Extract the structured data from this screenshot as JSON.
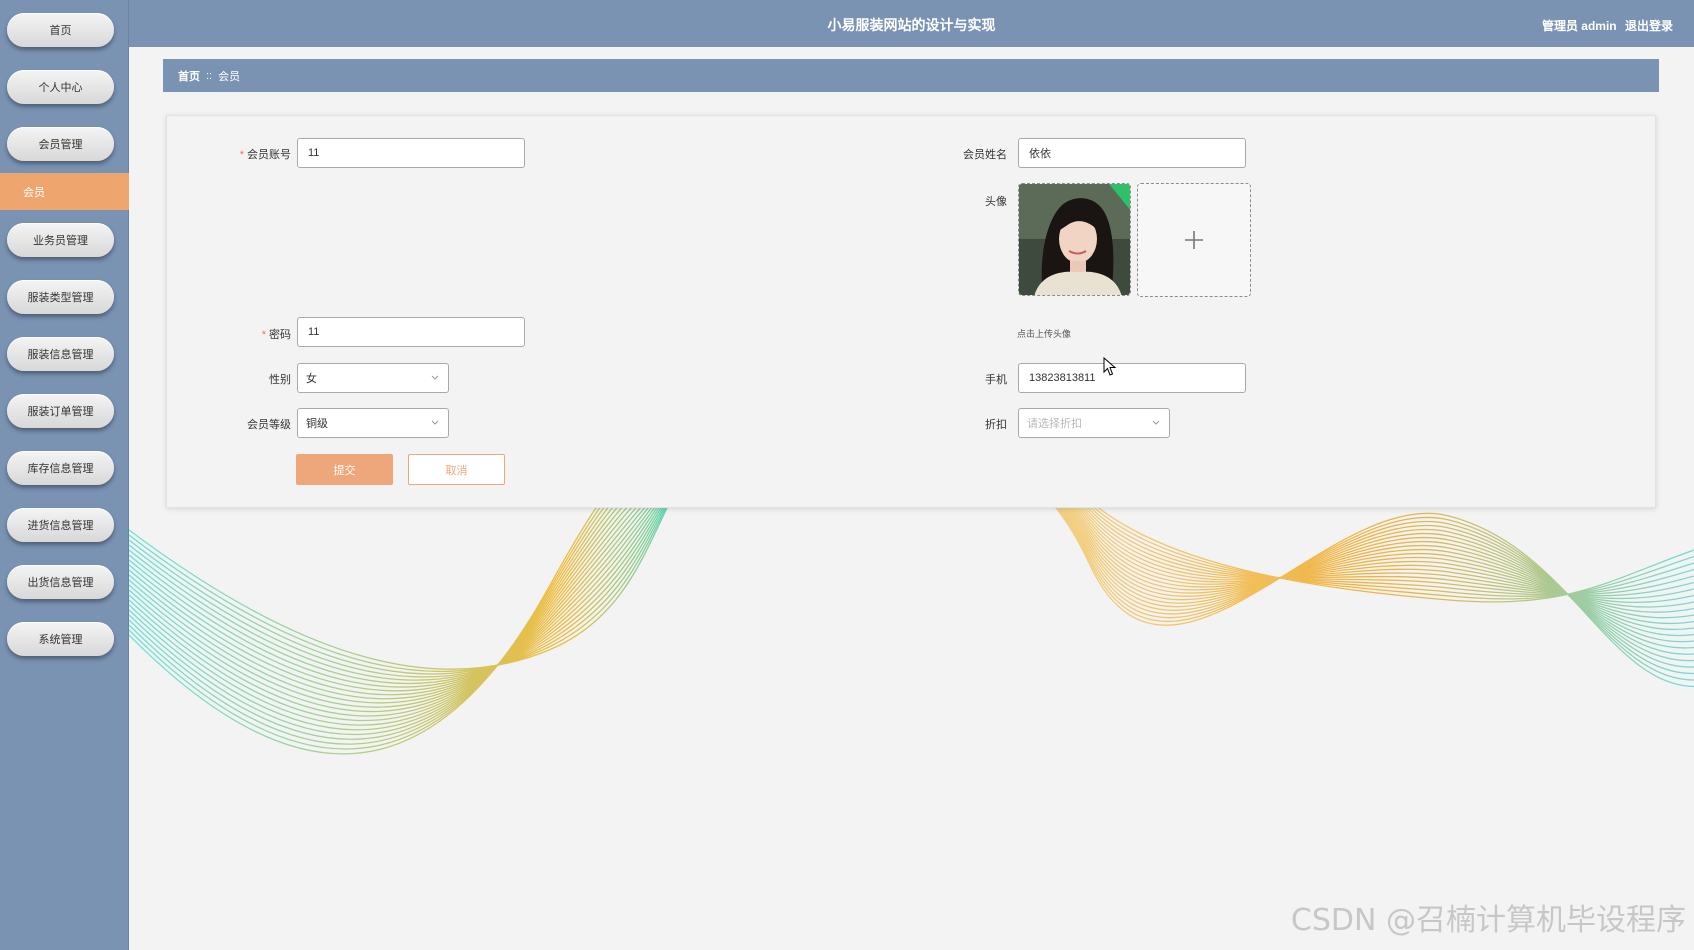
{
  "app": {
    "title": "小易服装网站的设计与实现",
    "user": "管理员 admin",
    "logout": "退出登录"
  },
  "sidebar": {
    "items": [
      {
        "label": "首页"
      },
      {
        "label": "个人中心"
      },
      {
        "label": "会员管理"
      },
      {
        "label": "业务员管理"
      },
      {
        "label": "服装类型管理"
      },
      {
        "label": "服装信息管理"
      },
      {
        "label": "服装订单管理"
      },
      {
        "label": "库存信息管理"
      },
      {
        "label": "进货信息管理"
      },
      {
        "label": "出货信息管理"
      },
      {
        "label": "系统管理"
      }
    ],
    "active_sub": "会员"
  },
  "breadcrumb": {
    "home": "首页",
    "separator": "::",
    "current": "会员"
  },
  "form": {
    "account": {
      "label": "会员账号",
      "value": "11",
      "required": true
    },
    "name": {
      "label": "会员姓名",
      "value": "依依"
    },
    "avatar": {
      "label": "头像",
      "hint": "点击上传头像",
      "upload_icon": "plus-icon"
    },
    "password": {
      "label": "密码",
      "value": "11",
      "required": true
    },
    "gender": {
      "label": "性别",
      "value": "女"
    },
    "phone": {
      "label": "手机",
      "value": "13823813811"
    },
    "level": {
      "label": "会员等级",
      "value": "铜级"
    },
    "discount": {
      "label": "折扣",
      "placeholder": "请选择折扣"
    },
    "submit": "提交",
    "cancel": "取消"
  },
  "watermark": "CSDN @召楠计算机毕设程序",
  "colors": {
    "nav": "#7a93b3",
    "accent": "#eea56e",
    "required": "#f56c6c"
  }
}
